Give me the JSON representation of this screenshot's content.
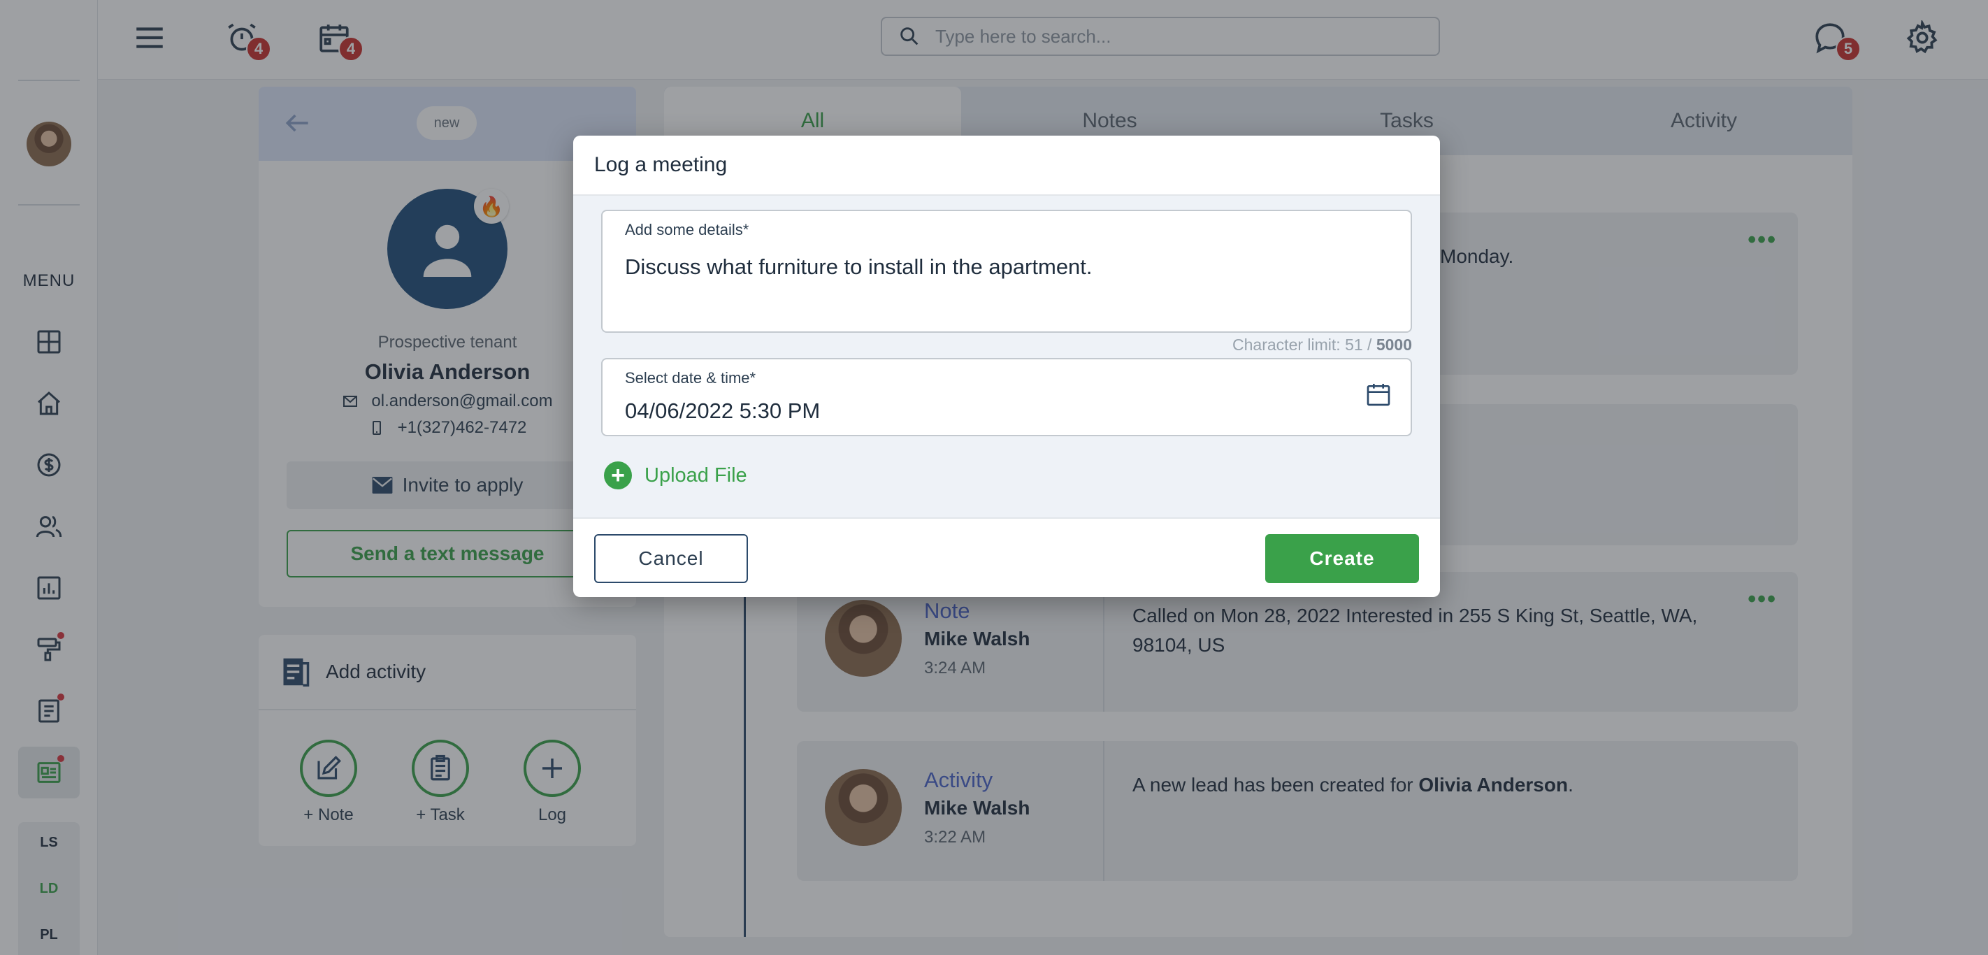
{
  "topbar": {
    "search_placeholder": "Type here to search...",
    "alarm_badge": "4",
    "calendar_badge": "4",
    "chat_badge": "5"
  },
  "sidebar": {
    "menu_label": "MENU",
    "codes": [
      "LS",
      "LD",
      "PL"
    ]
  },
  "profile": {
    "status_tag": "new",
    "role": "Prospective tenant",
    "name": "Olivia Anderson",
    "email": "ol.anderson@gmail.com",
    "phone": "+1(327)462-7472",
    "invite_label": "Invite to apply",
    "text_label": "Send a text message"
  },
  "add_activity": {
    "title": "Add activity",
    "note_label": "+ Note",
    "task_label": "+ Task",
    "log_label": "Log"
  },
  "timeline": {
    "tabs": [
      "All",
      "Notes",
      "Tasks",
      "Activity"
    ],
    "partial_text_1": "Monday.",
    "entries": [
      {
        "kind": "Note",
        "who": "Mike Walsh",
        "when": "3:24 AM",
        "message": "Called on Mon 28, 2022 Interested in 255 S King St, Seattle, WA, 98104, US"
      },
      {
        "kind": "Activity",
        "who": "Mike Walsh",
        "when": "3:22 AM",
        "message_pre": "A new lead has been created for ",
        "message_bold": "Olivia Anderson",
        "message_post": "."
      }
    ]
  },
  "modal": {
    "title": "Log a meeting",
    "details_label": "Add some details*",
    "details_value": "Discuss what furniture to install in the apartment.",
    "char_limit_prefix": "Character limit: 51 / ",
    "char_limit_max": "5000",
    "date_label": "Select date & time*",
    "date_value": "04/06/2022 5:30 PM",
    "upload_label": "Upload File",
    "cancel_label": "Cancel",
    "create_label": "Create"
  },
  "colors": {
    "accent_green": "#3aa14a",
    "badge_red": "#c9302c",
    "link_blue": "#4a63c9"
  }
}
